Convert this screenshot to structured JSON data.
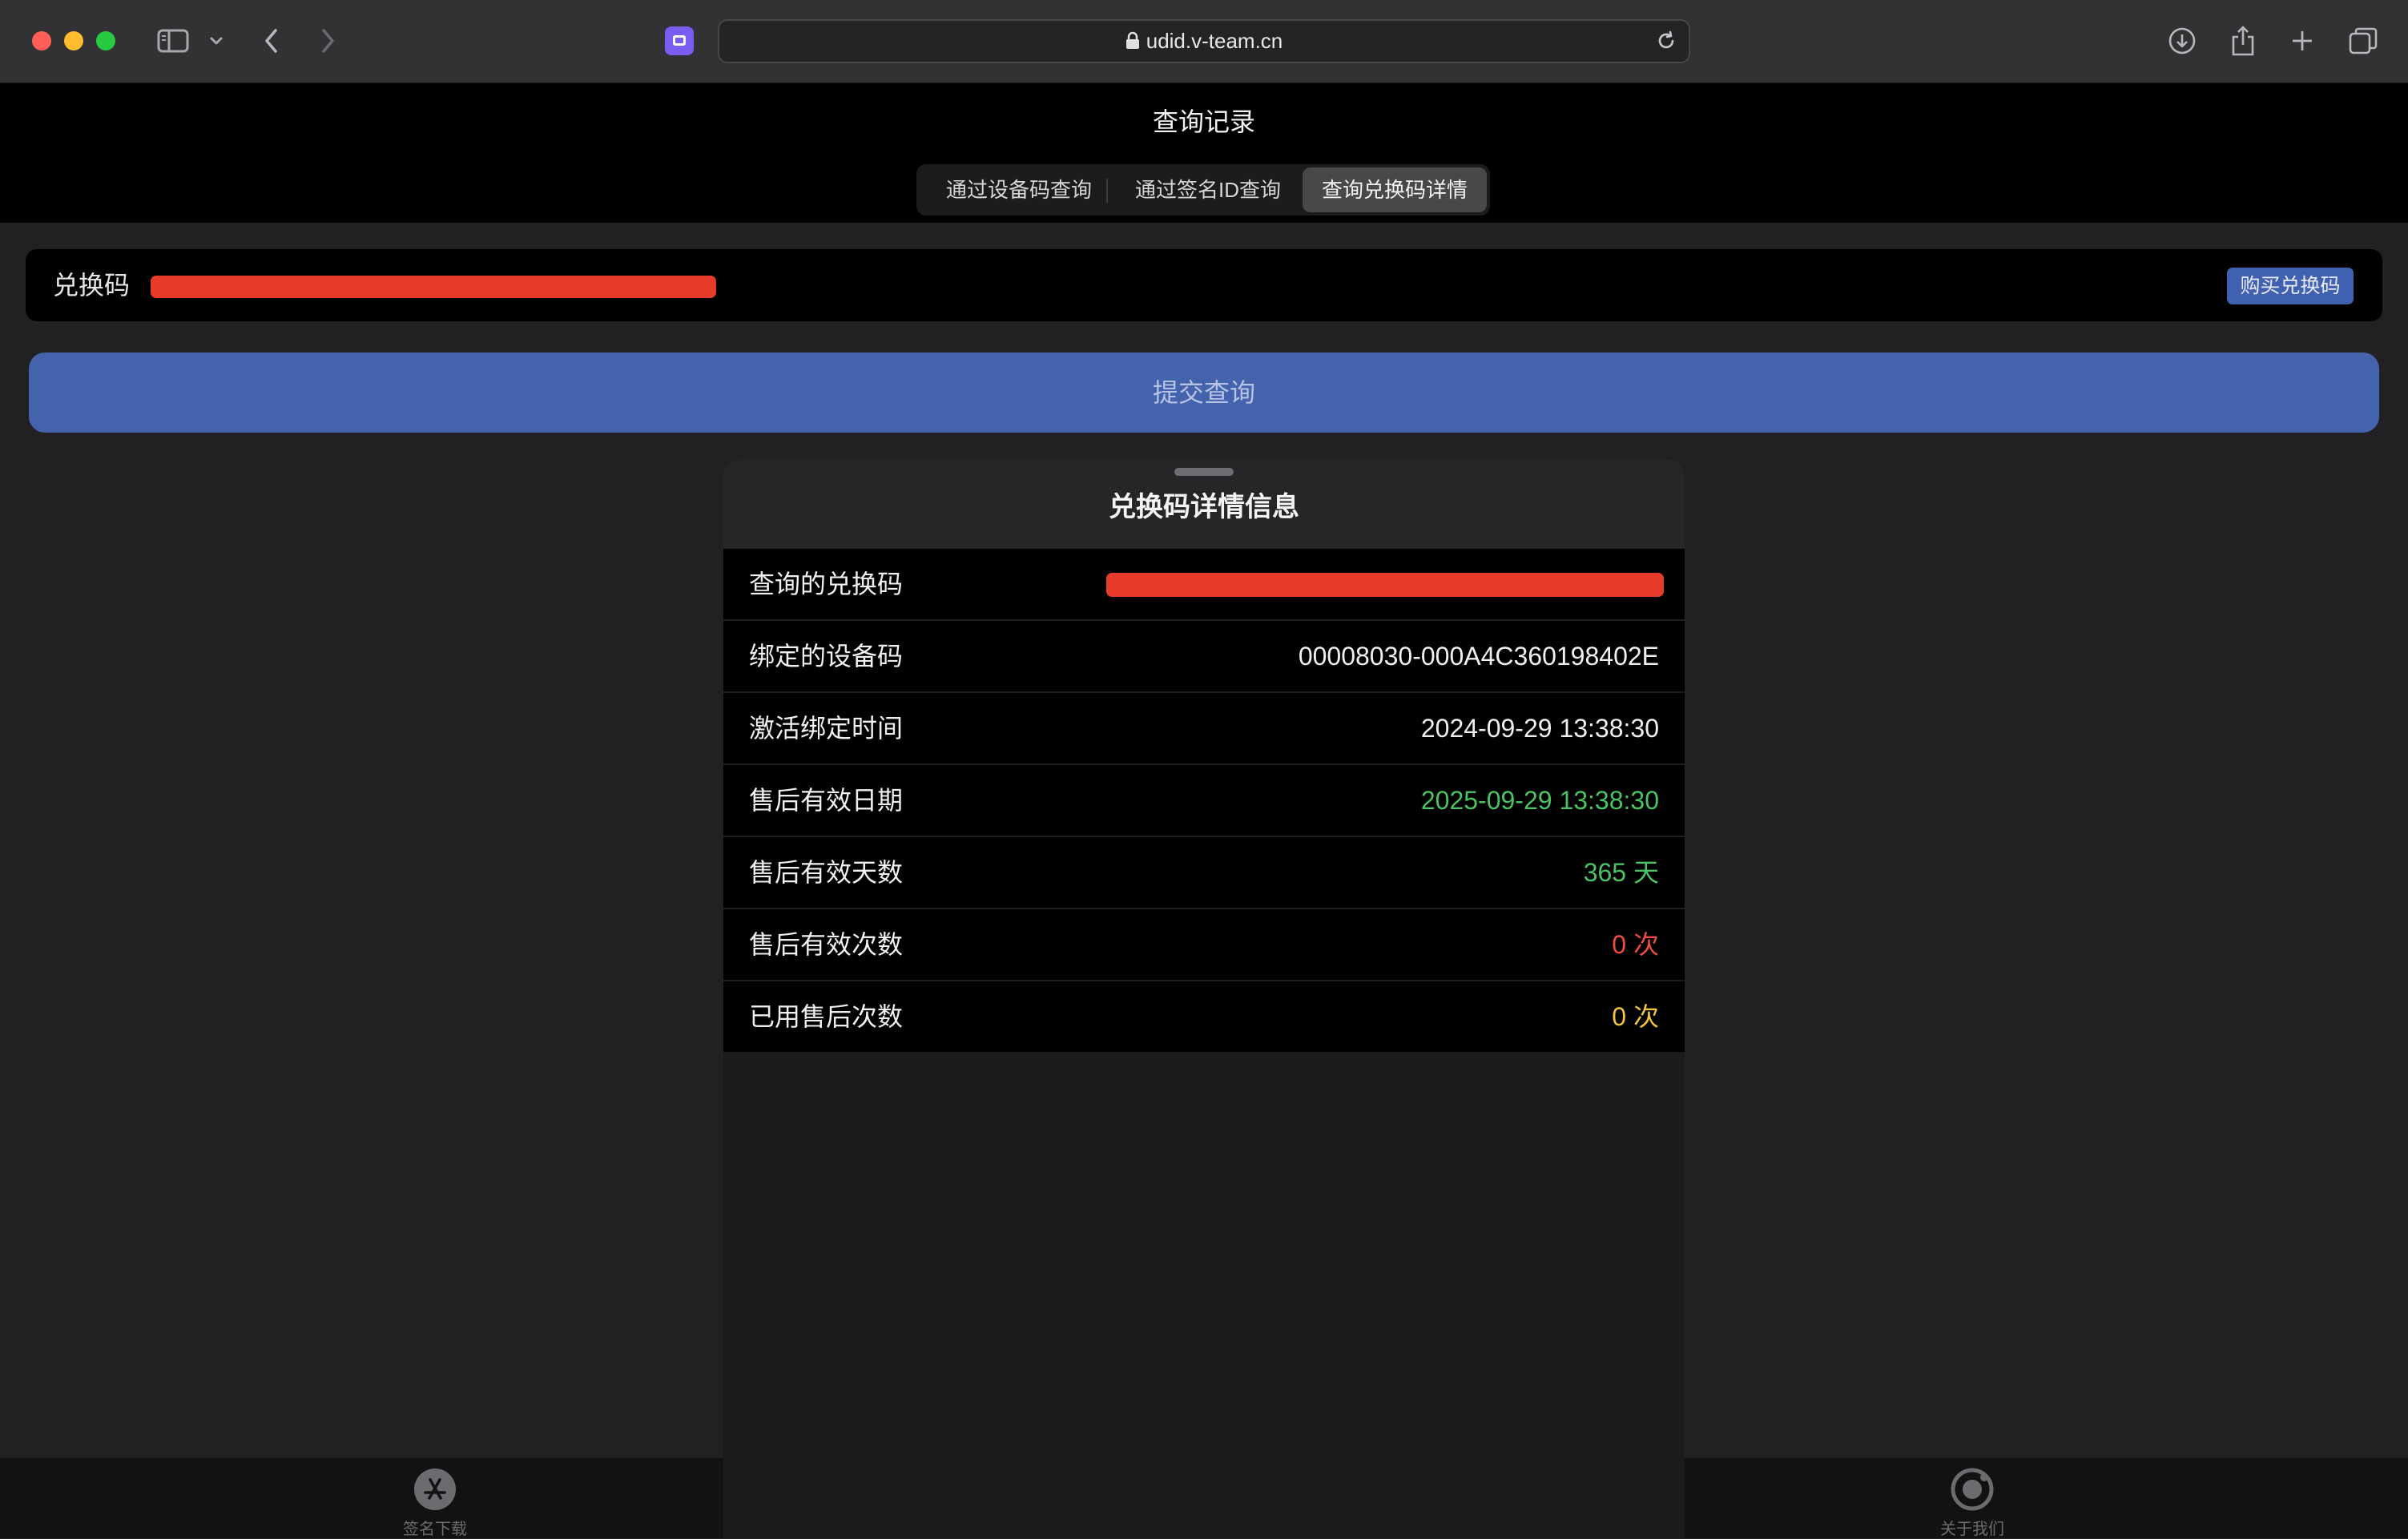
{
  "browser": {
    "url": "udid.v-team.cn"
  },
  "page": {
    "title": "查询记录",
    "segments": [
      {
        "label": "通过设备码查询",
        "active": false
      },
      {
        "label": "通过签名ID查询",
        "active": false
      },
      {
        "label": "查询兑换码详情",
        "active": true
      }
    ]
  },
  "code_input": {
    "label": "兑换码",
    "buy_label": "购买兑换码",
    "redacted_color": "#e63a2b"
  },
  "submit": {
    "label": "提交查询",
    "color": "#4562ad"
  },
  "sheet": {
    "title": "兑换码详情信息",
    "rows": [
      {
        "label": "查询的兑换码",
        "value": "",
        "redacted": true
      },
      {
        "label": "绑定的设备码",
        "value": "00008030-000A4C360198402E",
        "color": "#f0f0f0"
      },
      {
        "label": "激活绑定时间",
        "value": "2024-09-29 13:38:30",
        "color": "#f0f0f0"
      },
      {
        "label": "售后有效日期",
        "value": "2025-09-29 13:38:30",
        "color": "#4cc264"
      },
      {
        "label": "售后有效天数",
        "value": "365 天",
        "color": "#4cc264"
      },
      {
        "label": "售后有效次数",
        "value": "0 次",
        "color": "#ee4c42"
      },
      {
        "label": "已用售后次数",
        "value": "0 次",
        "color": "#f2c53d"
      }
    ]
  },
  "tabbar": {
    "items": [
      {
        "label": "签名下载",
        "icon": "app-store-icon"
      },
      {
        "label": "关于我们",
        "icon": "about-icon"
      }
    ]
  }
}
